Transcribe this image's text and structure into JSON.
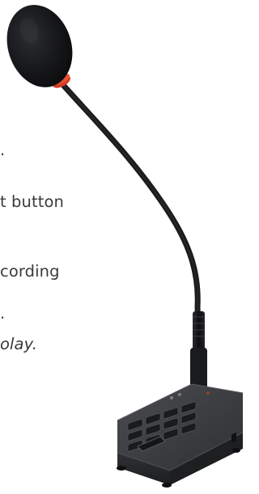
{
  "text_fragments": [
    ".",
    "t button",
    "cording",
    ".",
    "olay."
  ],
  "object": {
    "icon_name": "paging-microphone-icon"
  },
  "colors": {
    "foam": "#151518",
    "ring": "#d43a22",
    "gooseneck": "#1b1b1d",
    "base_top": "#3b3d40",
    "base_front": "#2a2c2f",
    "base_side": "#1f2022"
  }
}
